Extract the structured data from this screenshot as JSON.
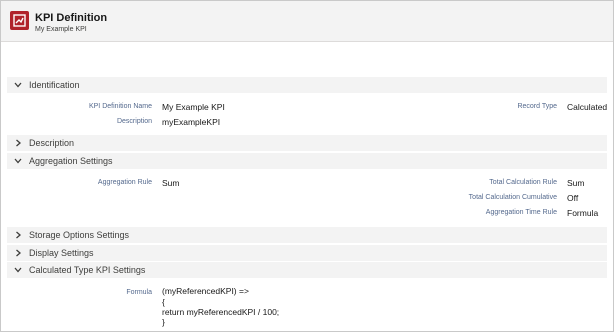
{
  "header": {
    "title": "KPI Definition",
    "subtitle": "My Example KPI"
  },
  "sections": {
    "identification": "Identification",
    "description": "Description",
    "aggregation": "Aggregation Settings",
    "storage": "Storage Options Settings",
    "display": "Display Settings",
    "calculated": "Calculated Type KPI Settings"
  },
  "identification": {
    "kpi_name_label": "KPI Definition Name",
    "kpi_name_value": "My Example KPI",
    "description_label": "Description",
    "description_value": "myExampleKPI",
    "record_type_label": "Record Type",
    "record_type_value": "Calculated"
  },
  "aggregation": {
    "rule_label": "Aggregation Rule",
    "rule_value": "Sum",
    "total_calc_label": "Total Calculation Rule",
    "total_calc_value": "Sum",
    "total_cumulative_label": "Total Calculation Cumulative",
    "total_cumulative_value": "Off",
    "time_rule_label": "Aggregation Time Rule",
    "time_rule_value": "Formula"
  },
  "calculated": {
    "formula_label": "Formula",
    "formula_line1": "(myReferencedKPI) =>",
    "formula_line2": "{",
    "formula_line3": "return myReferencedKPI / 100;",
    "formula_line4": "}"
  },
  "colors": {
    "brand": "#b0222b",
    "section_bg": "#f3f3f3",
    "label": "#54698d"
  },
  "icons": {
    "logo": "kpi-logo-icon",
    "expanded": "chevron-down-icon",
    "collapsed": "chevron-right-icon"
  }
}
